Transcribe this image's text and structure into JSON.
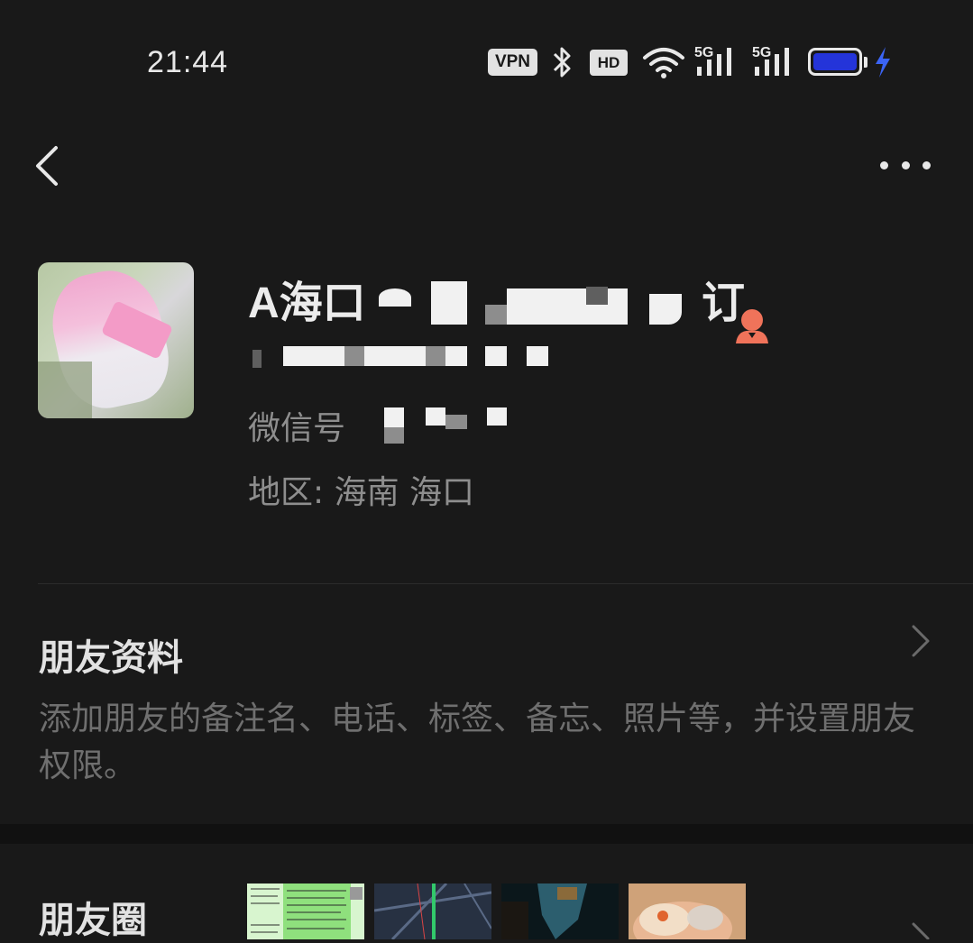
{
  "status_bar": {
    "time": "21:44",
    "vpn_label": "VPN",
    "hd_label": "HD",
    "network_1": "5G",
    "network_2": "5G",
    "icons": [
      "bluetooth-icon",
      "wifi-icon",
      "signal-icon",
      "battery-icon",
      "charging-icon"
    ],
    "battery_color": "#2434d9"
  },
  "nav": {
    "back_icon": "chevron-left-icon",
    "more_icon": "more-dots-icon"
  },
  "profile": {
    "name_prefix": "A海口",
    "name_suffix": "订",
    "wechat_id_label": "微信号",
    "region_label": "地区:",
    "region_value": "海南  海口",
    "gender_icon": "female-icon",
    "gender_color": "#f0735a"
  },
  "friend_info": {
    "title": "朋友资料",
    "description": "添加朋友的备注名、电话、标签、备忘、照片等，并设置朋友权限。"
  },
  "moments": {
    "title": "朋友圈"
  }
}
